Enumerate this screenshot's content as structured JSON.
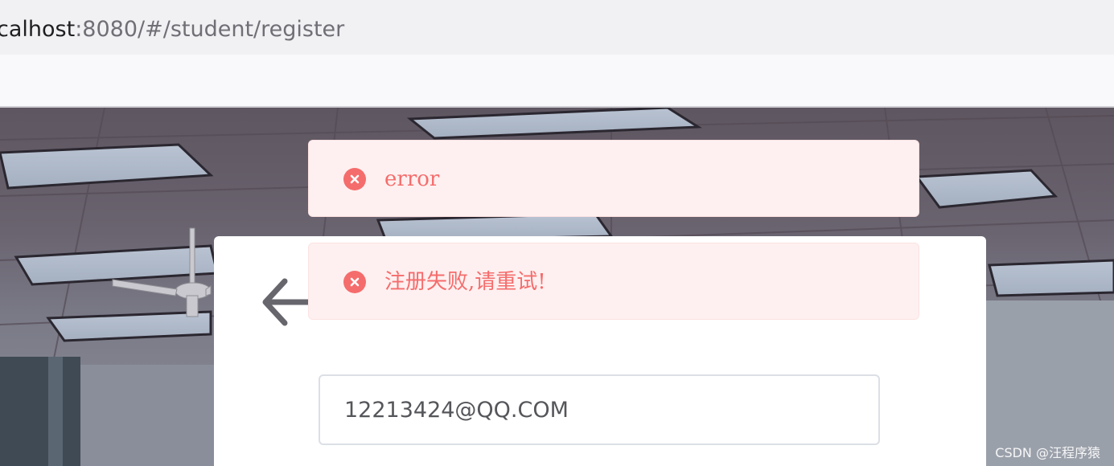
{
  "browser": {
    "url_host": "calhost",
    "url_rest": ":8080/#/student/register"
  },
  "form": {
    "email_value": "12213424@QQ.COM"
  },
  "messages": [
    {
      "type": "error",
      "text": "error"
    },
    {
      "type": "error",
      "text": "注册失败,请重试!"
    }
  ],
  "icons": {
    "back": "arrow-left-icon",
    "message": "circle-close-icon"
  },
  "colors": {
    "error_text": "#f56c6c",
    "error_bg": "#fef0f0",
    "error_border": "#fde2e2"
  },
  "watermark": "CSDN @汪程序猿"
}
